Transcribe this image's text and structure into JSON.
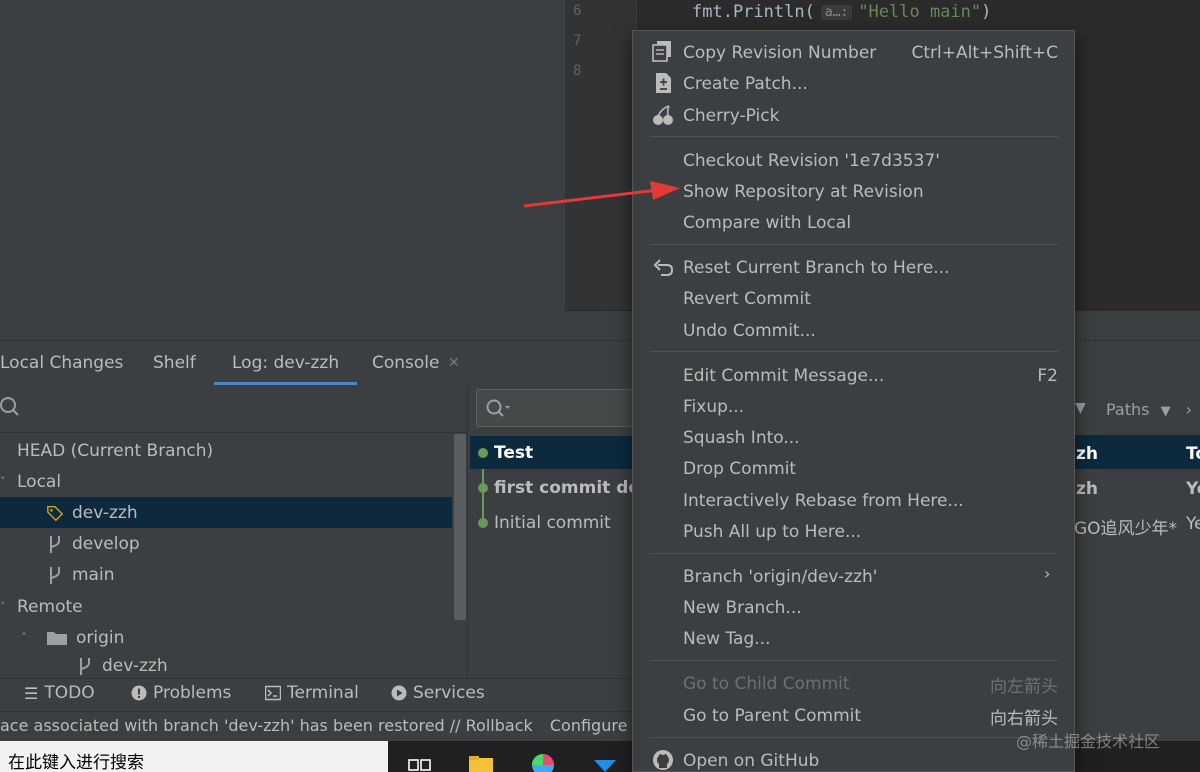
{
  "editor": {
    "line_numbers": [
      "6",
      "7",
      "8"
    ],
    "code": {
      "func": "fmt.Println(",
      "hint": "a…:",
      "string": "\"Hello main\"",
      "close": ")"
    }
  },
  "tabs": [
    {
      "label": "Local Changes"
    },
    {
      "label": "Shelf"
    },
    {
      "label": "Log: dev-zzh"
    },
    {
      "label": "Console"
    }
  ],
  "branch_tree": {
    "head": "HEAD (Current Branch)",
    "local": "Local",
    "local_branches": [
      "dev-zzh",
      "develop",
      "main"
    ],
    "remote": "Remote",
    "origin": "origin",
    "remote_branches": [
      "dev-zzh"
    ]
  },
  "commits": [
    {
      "message": "Test",
      "author": "zh",
      "date": "To"
    },
    {
      "message": "first commit dev",
      "author": "zh",
      "date": "Ye"
    },
    {
      "message": "Initial commit",
      "author": "GO追风少年*",
      "date": "Ye"
    }
  ],
  "filters": {
    "paths": "Paths"
  },
  "context_menu": {
    "copy_revision": "Copy Revision Number",
    "copy_revision_shortcut": "Ctrl+Alt+Shift+C",
    "create_patch": "Create Patch...",
    "cherry_pick": "Cherry-Pick",
    "checkout_revision": "Checkout Revision '1e7d3537'",
    "show_repository": "Show Repository at Revision",
    "compare_local": "Compare with Local",
    "reset_branch": "Reset Current Branch to Here...",
    "revert_commit": "Revert Commit",
    "undo_commit": "Undo Commit...",
    "edit_message": "Edit Commit Message...",
    "edit_message_shortcut": "F2",
    "fixup": "Fixup...",
    "squash": "Squash Into...",
    "drop_commit": "Drop Commit",
    "rebase": "Interactively Rebase from Here...",
    "push_all": "Push All up to Here...",
    "branch_submenu": "Branch 'origin/dev-zzh'",
    "new_branch": "New Branch...",
    "new_tag": "New Tag...",
    "go_child": "Go to Child Commit",
    "go_child_shortcut": "向左箭头",
    "go_parent": "Go to Parent Commit",
    "go_parent_shortcut": "向右箭头",
    "open_github": "Open on GitHub"
  },
  "tool_windows": [
    "TODO",
    "Problems",
    "Terminal",
    "Services"
  ],
  "status": {
    "message": "ace associated with branch 'dev-zzh' has been restored // Rollback",
    "configure": "Configure"
  },
  "taskbar": {
    "search_placeholder": "在此键入进行搜索"
  },
  "watermark": "@稀土掘金技术社区",
  "colors": {
    "selection": "#0d293e",
    "graph": "#6a9a5b",
    "arrow": "#e53935",
    "menu_bg": "#3c3f41"
  }
}
